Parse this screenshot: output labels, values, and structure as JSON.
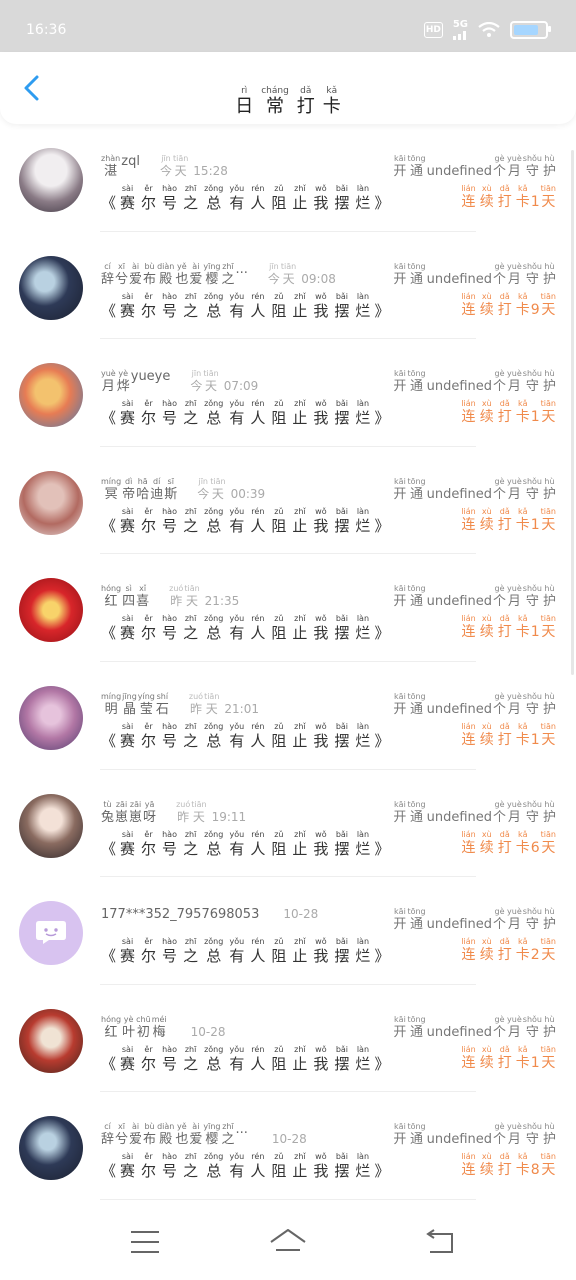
{
  "status_bar": {
    "time": "16:36",
    "hd": "HD",
    "network": "5G",
    "icons": [
      "hd-icon",
      "signal-icon",
      "wifi-icon",
      "battery-icon"
    ]
  },
  "header": {
    "title_chars": [
      {
        "py": "rì",
        "hz": "日"
      },
      {
        "py": "cháng",
        "hz": "常"
      },
      {
        "py": "dǎ",
        "hz": "打"
      },
      {
        "py": "kǎ",
        "hz": "卡"
      }
    ],
    "back_icon": "chevron-left-icon",
    "accent_color": "#2e9cf0"
  },
  "message_chars": [
    {
      "py": "sài",
      "hz": "赛"
    },
    {
      "py": "ěr",
      "hz": "尔"
    },
    {
      "py": "hào",
      "hz": "号"
    },
    {
      "py": "zhī",
      "hz": "之"
    },
    {
      "py": "zǒng",
      "hz": "总"
    },
    {
      "py": "yǒu",
      "hz": "有"
    },
    {
      "py": "rén",
      "hz": "人"
    },
    {
      "py": "zǔ",
      "hz": "阻"
    },
    {
      "py": "zhǐ",
      "hz": "止"
    },
    {
      "py": "wǒ",
      "hz": "我"
    },
    {
      "py": "bǎi",
      "hz": "摆"
    },
    {
      "py": "làn",
      "hz": "烂"
    }
  ],
  "message_open": "《",
  "message_close": "》",
  "vip": {
    "before": [
      {
        "py": "kāi",
        "hz": "开"
      },
      {
        "py": "tōng",
        "hz": "通"
      }
    ],
    "middle": "undefined",
    "after": [
      {
        "py": "gè",
        "hz": "个"
      },
      {
        "py": "yuè",
        "hz": "月"
      },
      {
        "py": "shǒu",
        "hz": "守"
      },
      {
        "py": "hù",
        "hz": "护"
      }
    ]
  },
  "streak": {
    "before": [
      {
        "py": "lián",
        "hz": "连"
      },
      {
        "py": "xù",
        "hz": "续"
      },
      {
        "py": "dǎ",
        "hz": "打"
      },
      {
        "py": "kǎ",
        "hz": "卡"
      }
    ],
    "after": [
      {
        "py": "tiān",
        "hz": "天"
      }
    ],
    "color": "#f08a4b"
  },
  "rows": [
    {
      "name_chars": [
        {
          "py": "zhàn",
          "hz": "湛"
        }
      ],
      "name_suffix": "zql",
      "time_chars": [
        {
          "py": "jīn",
          "hz": "今"
        },
        {
          "py": "tiān",
          "hz": "天"
        }
      ],
      "clock": "15:28",
      "streak_days": "1"
    },
    {
      "name_chars": [
        {
          "py": "cí",
          "hz": "辞"
        },
        {
          "py": "xī",
          "hz": "兮"
        },
        {
          "py": "ài",
          "hz": "爱"
        },
        {
          "py": "bù",
          "hz": "布"
        },
        {
          "py": "diàn",
          "hz": "殿"
        },
        {
          "py": "yě",
          "hz": "也"
        },
        {
          "py": "ài",
          "hz": "爱"
        },
        {
          "py": "yīng",
          "hz": "樱"
        },
        {
          "py": "zhī",
          "hz": "之"
        }
      ],
      "name_suffix": "...",
      "time_chars": [
        {
          "py": "jīn",
          "hz": "今"
        },
        {
          "py": "tiān",
          "hz": "天"
        }
      ],
      "clock": "09:08",
      "streak_days": "9"
    },
    {
      "name_chars": [
        {
          "py": "yuè",
          "hz": "月"
        },
        {
          "py": "yè",
          "hz": "烨"
        }
      ],
      "name_suffix": "yueye",
      "time_chars": [
        {
          "py": "jīn",
          "hz": "今"
        },
        {
          "py": "tiān",
          "hz": "天"
        }
      ],
      "clock": "07:09",
      "streak_days": "1"
    },
    {
      "name_chars": [
        {
          "py": "míng",
          "hz": "冥"
        },
        {
          "py": "dì",
          "hz": "帝"
        },
        {
          "py": "hā",
          "hz": "哈"
        },
        {
          "py": "dí",
          "hz": "迪"
        },
        {
          "py": "sī",
          "hz": "斯"
        }
      ],
      "name_suffix": "",
      "time_chars": [
        {
          "py": "jīn",
          "hz": "今"
        },
        {
          "py": "tiān",
          "hz": "天"
        }
      ],
      "clock": "00:39",
      "streak_days": "1"
    },
    {
      "name_chars": [
        {
          "py": "hóng",
          "hz": "红"
        },
        {
          "py": "sì",
          "hz": "四"
        },
        {
          "py": "xǐ",
          "hz": "喜"
        }
      ],
      "name_suffix": "",
      "time_chars": [
        {
          "py": "zuó",
          "hz": "昨"
        },
        {
          "py": "tiān",
          "hz": "天"
        }
      ],
      "clock": "21:35",
      "streak_days": "1"
    },
    {
      "name_chars": [
        {
          "py": "míng",
          "hz": "明"
        },
        {
          "py": "jīng",
          "hz": "晶"
        },
        {
          "py": "yíng",
          "hz": "莹"
        },
        {
          "py": "shí",
          "hz": "石"
        }
      ],
      "name_suffix": "",
      "time_chars": [
        {
          "py": "zuó",
          "hz": "昨"
        },
        {
          "py": "tiān",
          "hz": "天"
        }
      ],
      "clock": "21:01",
      "streak_days": "1"
    },
    {
      "name_chars": [
        {
          "py": "tù",
          "hz": "兔"
        },
        {
          "py": "zāi",
          "hz": "崽"
        },
        {
          "py": "zāi",
          "hz": "崽"
        },
        {
          "py": "yā",
          "hz": "呀"
        }
      ],
      "name_suffix": "",
      "time_chars": [
        {
          "py": "zuó",
          "hz": "昨"
        },
        {
          "py": "tiān",
          "hz": "天"
        }
      ],
      "clock": "19:11",
      "streak_days": "6"
    },
    {
      "name_chars": [],
      "name_suffix": "177***352_7957698053",
      "time_chars": [],
      "clock": "10-28",
      "streak_days": "2"
    },
    {
      "name_chars": [
        {
          "py": "hóng",
          "hz": "红"
        },
        {
          "py": "yè",
          "hz": "叶"
        },
        {
          "py": "chū",
          "hz": "初"
        },
        {
          "py": "méi",
          "hz": "梅"
        }
      ],
      "name_suffix": "",
      "time_chars": [],
      "clock": "10-28",
      "streak_days": "1"
    },
    {
      "name_chars": [
        {
          "py": "cí",
          "hz": "辞"
        },
        {
          "py": "xī",
          "hz": "兮"
        },
        {
          "py": "ài",
          "hz": "爱"
        },
        {
          "py": "bù",
          "hz": "布"
        },
        {
          "py": "diàn",
          "hz": "殿"
        },
        {
          "py": "yě",
          "hz": "也"
        },
        {
          "py": "ài",
          "hz": "爱"
        },
        {
          "py": "yīng",
          "hz": "樱"
        },
        {
          "py": "zhī",
          "hz": "之"
        }
      ],
      "name_suffix": "...",
      "time_chars": [],
      "clock": "10-28",
      "streak_days": "8"
    }
  ],
  "navbar": {
    "icons": [
      "menu-icon",
      "home-icon",
      "back-icon"
    ]
  }
}
